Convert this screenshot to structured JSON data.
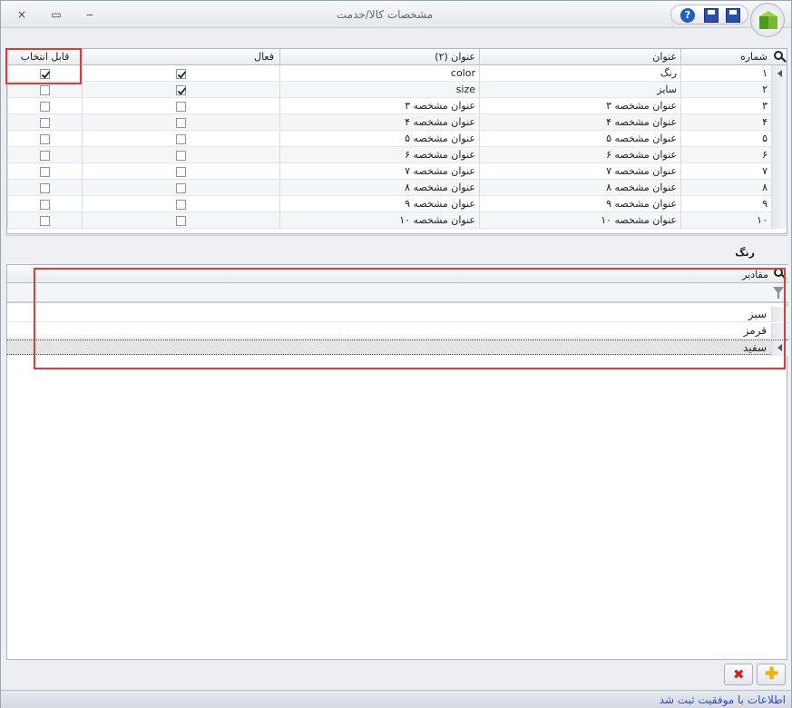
{
  "window": {
    "title": "مشخصات کالا/خدمت",
    "controls": {
      "close": "×",
      "maximize": "▭",
      "minimize": "‒"
    },
    "quick_access": {
      "help": "?"
    }
  },
  "features_grid": {
    "columns": {
      "selectable": "قابل انتخاب",
      "active": "فعال",
      "title2": "عنوان (۲)",
      "title": "عنوان",
      "number": "شماره"
    },
    "rows": [
      {
        "number": "۱",
        "title": "رنگ",
        "title2": "color",
        "active": true,
        "selectable": true
      },
      {
        "number": "۲",
        "title": "سایز",
        "title2": "size",
        "active": true,
        "selectable": false
      },
      {
        "number": "۳",
        "title": "عنوان مشخصه ۳",
        "title2": "عنوان مشخصه ۳",
        "active": false,
        "selectable": false
      },
      {
        "number": "۴",
        "title": "عنوان مشخصه ۴",
        "title2": "عنوان مشخصه ۴",
        "active": false,
        "selectable": false
      },
      {
        "number": "۵",
        "title": "عنوان مشخصه ۵",
        "title2": "عنوان مشخصه ۵",
        "active": false,
        "selectable": false
      },
      {
        "number": "۶",
        "title": "عنوان مشخصه ۶",
        "title2": "عنوان مشخصه ۶",
        "active": false,
        "selectable": false
      },
      {
        "number": "۷",
        "title": "عنوان مشخصه ۷",
        "title2": "عنوان مشخصه ۷",
        "active": false,
        "selectable": false
      },
      {
        "number": "۸",
        "title": "عنوان مشخصه ۸",
        "title2": "عنوان مشخصه ۸",
        "active": false,
        "selectable": false
      },
      {
        "number": "۹",
        "title": "عنوان مشخصه ۹",
        "title2": "عنوان مشخصه ۹",
        "active": false,
        "selectable": false
      },
      {
        "number": "۱۰",
        "title": "عنوان مشخصه ۱۰",
        "title2": "عنوان مشخصه ۱۰",
        "active": false,
        "selectable": false
      }
    ]
  },
  "values_section": {
    "label": "رنگ",
    "column": "مقادیر",
    "values": [
      {
        "text": "سبز",
        "selected": false
      },
      {
        "text": "قرمز",
        "selected": false
      },
      {
        "text": "سفید",
        "selected": true
      }
    ]
  },
  "buttons": {
    "delete": "✖",
    "add": "✚"
  },
  "status": {
    "message": "اطلاعات با موفقیت ثبت شد"
  },
  "colors": {
    "highlight": "#e03a3a",
    "status_text": "#2b4fbf",
    "delete": "#d41f1f",
    "add": "#f0b400"
  }
}
